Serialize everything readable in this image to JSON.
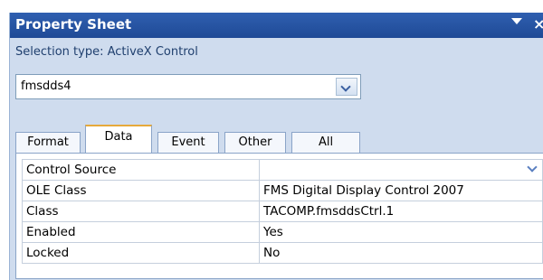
{
  "window": {
    "title": "Property Sheet",
    "menu_icon": "dropdown-arrow-icon",
    "close_label": "×"
  },
  "selection_type": "Selection type:  ActiveX Control",
  "object_combo": {
    "value": "fmsdds4",
    "icon": "chevron-down-icon"
  },
  "tabs": [
    {
      "label": "Format",
      "active": false
    },
    {
      "label": "Data",
      "active": true
    },
    {
      "label": "Event",
      "active": false
    },
    {
      "label": "Other",
      "active": false
    },
    {
      "label": "All",
      "active": false
    }
  ],
  "properties": [
    {
      "name": "Control Source",
      "value": "",
      "has_dropdown": true
    },
    {
      "name": "OLE Class",
      "value": "FMS Digital Display Control 2007"
    },
    {
      "name": "Class",
      "value": "TACOMP.fmsddsCtrl.1"
    },
    {
      "name": "Enabled",
      "value": "Yes"
    },
    {
      "name": "Locked",
      "value": "No"
    }
  ],
  "colors": {
    "titlebar": "#1f4a96",
    "panel": "#cfdcee",
    "active_tab_accent": "#e6a93b"
  }
}
